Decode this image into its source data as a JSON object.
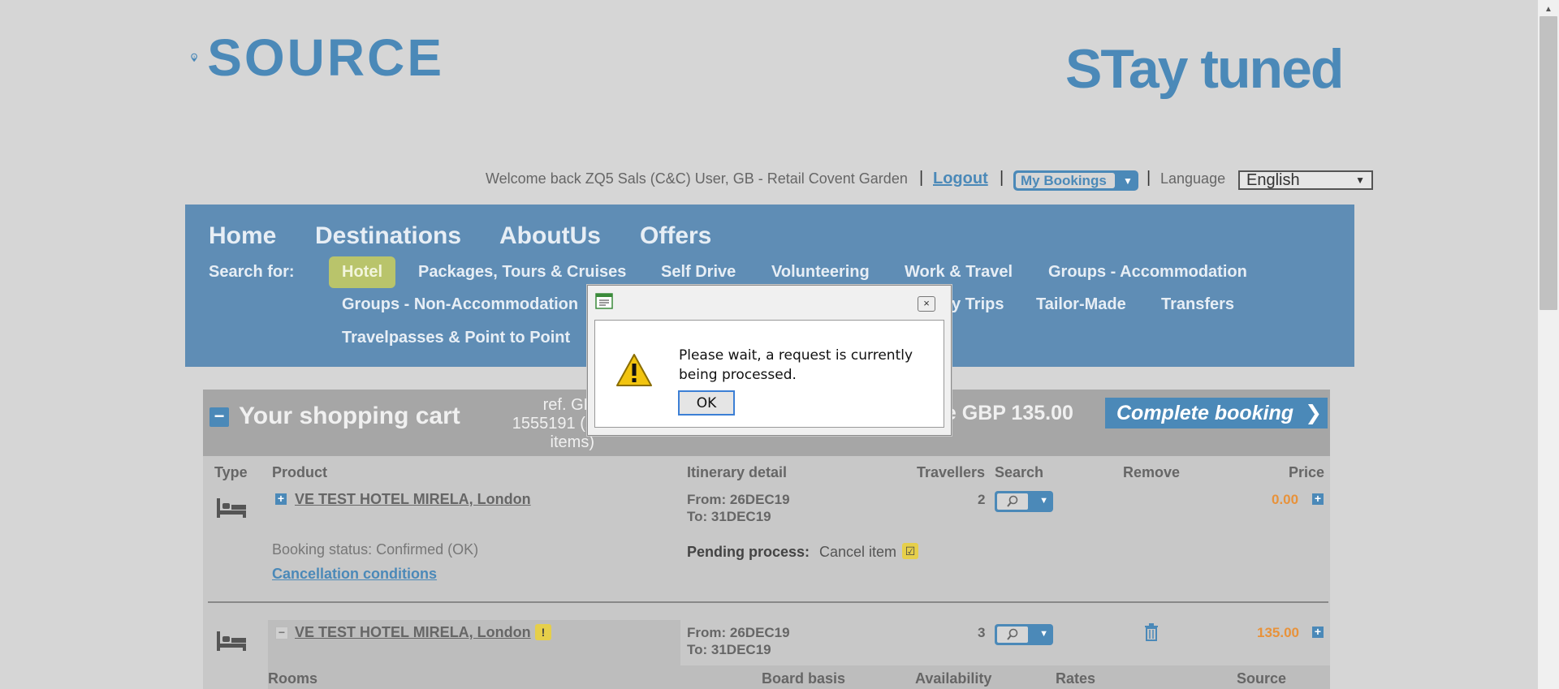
{
  "header": {
    "logo_left": "SOURCE",
    "logo_right": "STay tuned",
    "welcome": "Welcome back ZQ5 Sals (C&C) User, GB - Retail Covent Garden",
    "separator": "|",
    "logout": "Logout",
    "my_bookings": "My Bookings",
    "language_label": "Language",
    "language_value": "English"
  },
  "nav": {
    "main": [
      "Home",
      "Destinations",
      "AboutUs",
      "Offers"
    ],
    "search_for": "Search for:",
    "items": {
      "hotel": "Hotel",
      "packages": "Packages, Tours & Cruises",
      "self_drive": "Self Drive",
      "volunteering": "Volunteering",
      "work_travel": "Work & Travel",
      "groups_accommodation": "Groups - Accommodation",
      "groups_non": "Groups - Non-Accommodation",
      "day_trips": "y Trips",
      "tailor_made": "Tailor-Made",
      "transfers": "Transfers",
      "travelpasses": "Travelpasses & Point to Point"
    }
  },
  "cart": {
    "title": "Your shopping cart",
    "ref_lines": [
      "ref. GB",
      "1555191 (2",
      "items)"
    ],
    "price": "ce GBP 135.00",
    "complete_button": "Complete booking",
    "columns": {
      "type": "Type",
      "product": "Product",
      "itinerary": "Itinerary detail",
      "travellers": "Travellers",
      "search": "Search",
      "remove": "Remove",
      "price": "Price"
    },
    "items": [
      {
        "product": "VE TEST HOTEL MIRELA, London",
        "from": "From: 26DEC19",
        "to": "To: 31DEC19",
        "travellers": "2",
        "price": "0.00",
        "status": "Booking status: Confirmed (OK)",
        "cancel_link": "Cancellation conditions",
        "pending_label": "Pending process:",
        "pending_value": "Cancel item"
      },
      {
        "product": "VE TEST HOTEL MIRELA, London",
        "badge": "!",
        "from": "From: 26DEC19",
        "to": "To: 31DEC19",
        "travellers": "3",
        "price": "135.00"
      }
    ],
    "sub_columns": {
      "rooms": "Rooms",
      "board": "Board basis",
      "availability": "Availability",
      "rates": "Rates",
      "source": "Source"
    }
  },
  "dialog": {
    "message": "Please wait, a request is currently being processed.",
    "ok": "OK",
    "close": "×"
  },
  "colors": {
    "accent": "#4b89b8",
    "nav_bg": "#5f8db5",
    "active_tab": "#b9c46b",
    "price": "#e8923a"
  }
}
